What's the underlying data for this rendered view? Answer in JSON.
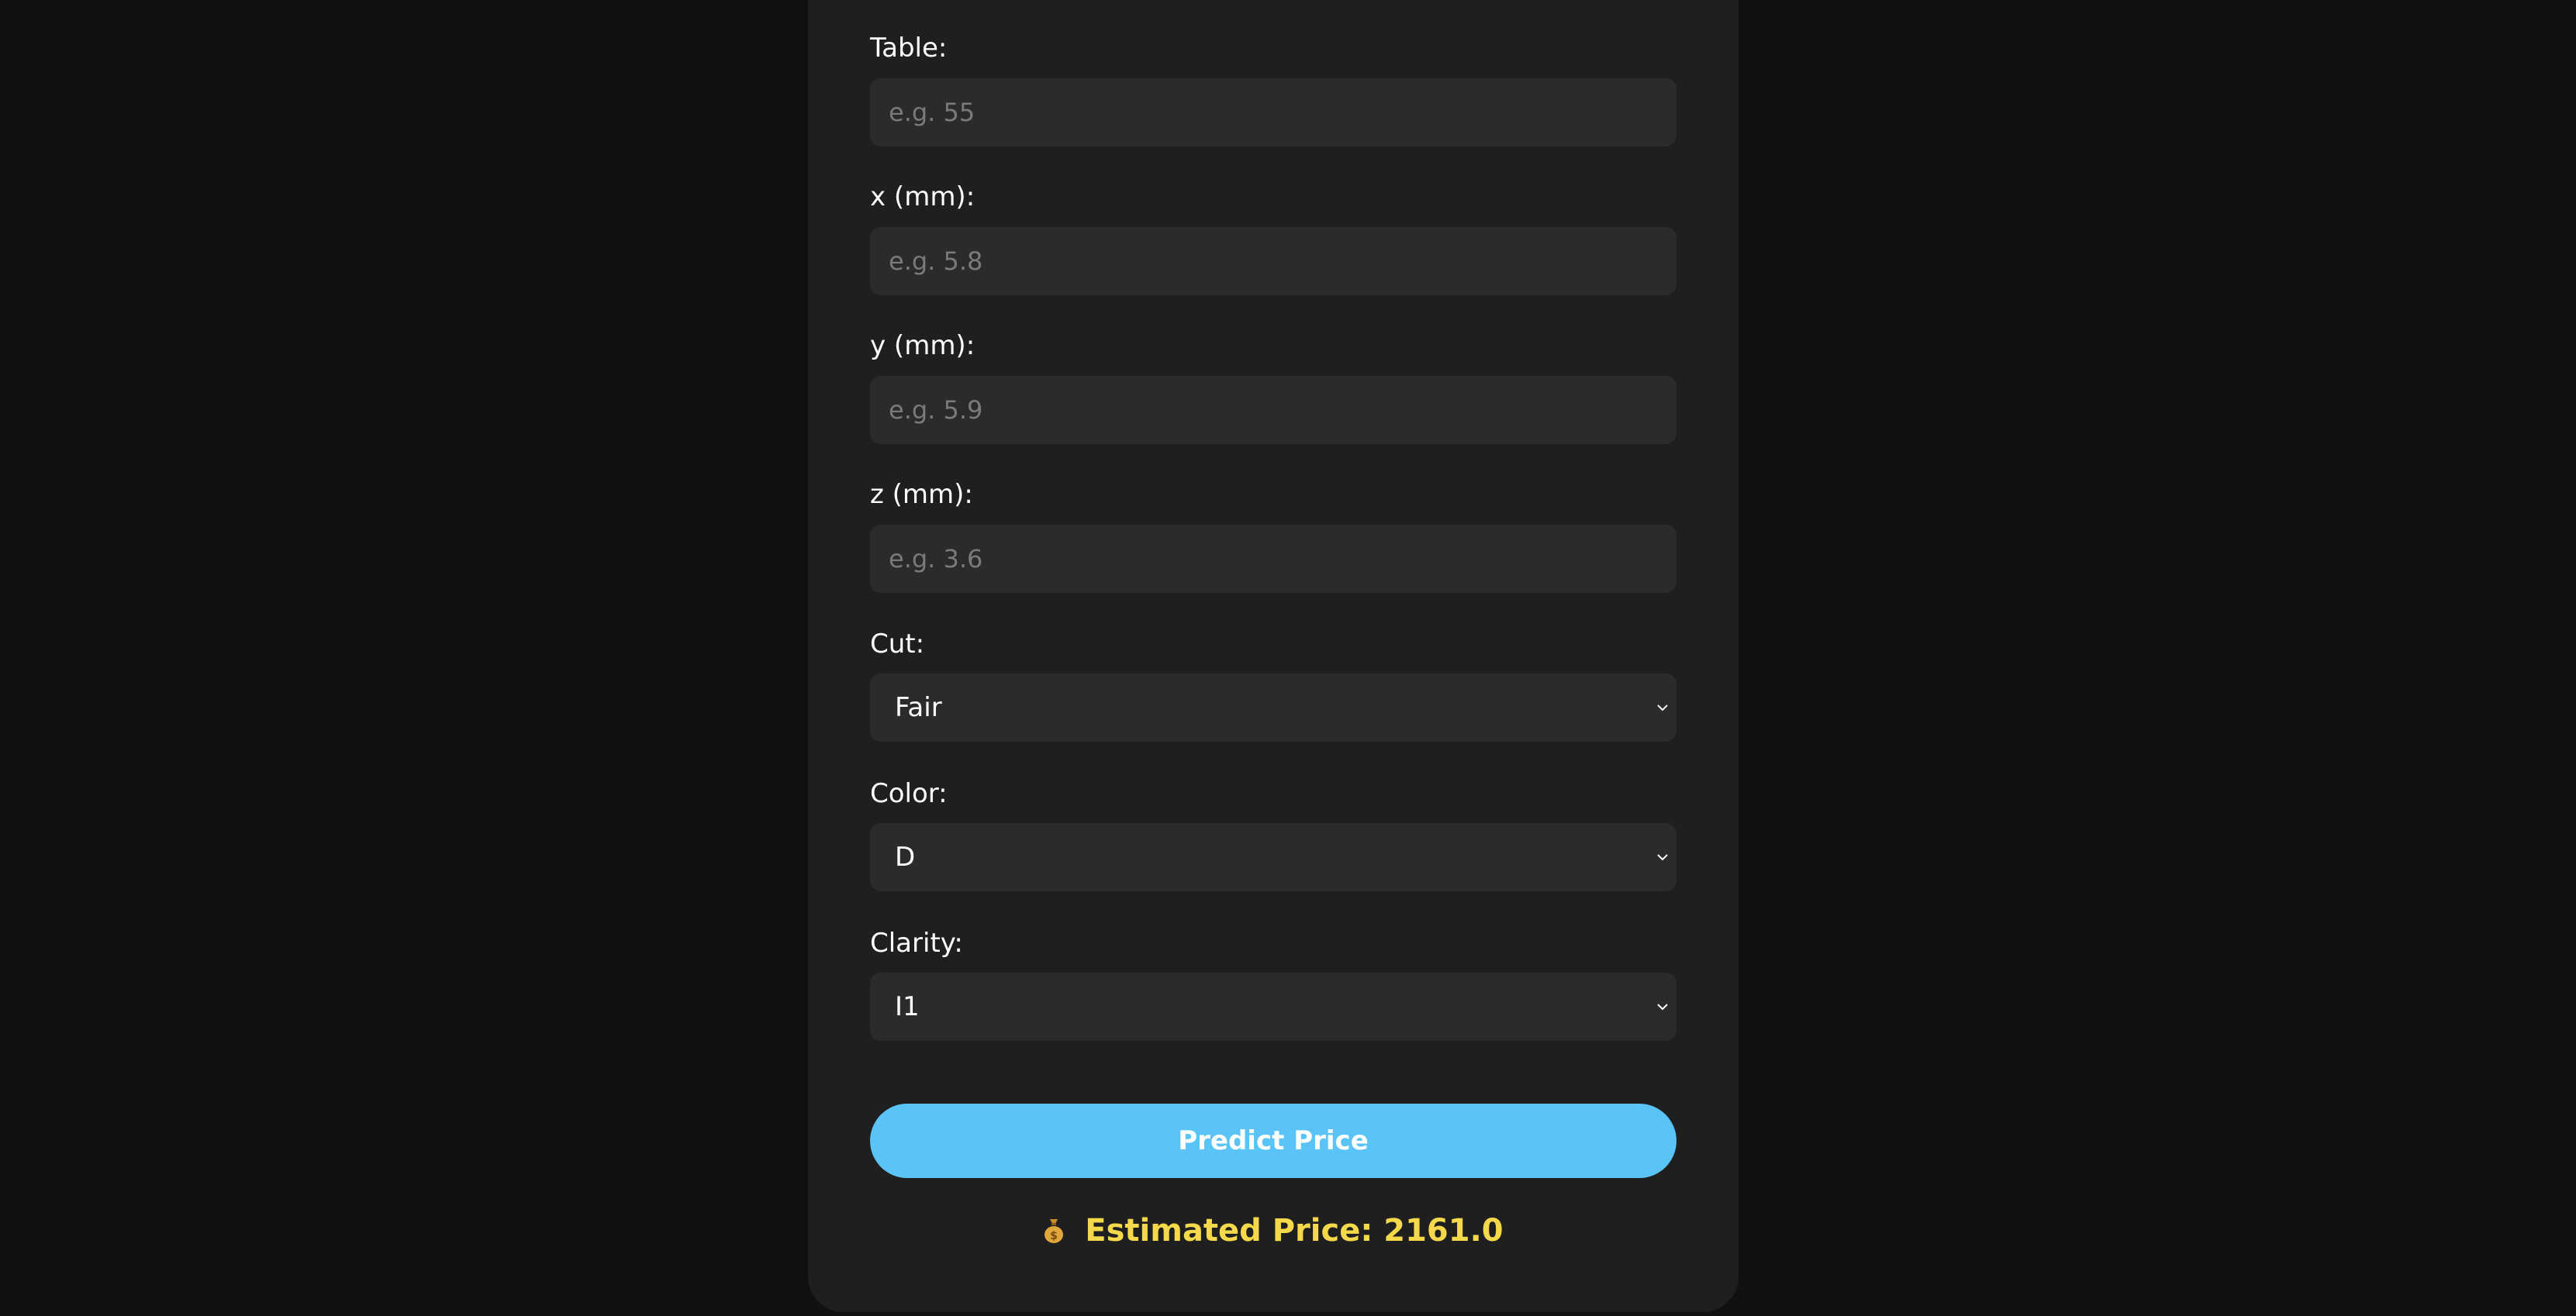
{
  "form": {
    "table": {
      "label": "Table:",
      "placeholder": "e.g. 55"
    },
    "x": {
      "label": "x (mm):",
      "placeholder": "e.g. 5.8"
    },
    "y": {
      "label": "y (mm):",
      "placeholder": "e.g. 5.9"
    },
    "z": {
      "label": "z (mm):",
      "placeholder": "e.g. 3.6"
    },
    "cut": {
      "label": "Cut:",
      "value": "Fair"
    },
    "color": {
      "label": "Color:",
      "value": "D"
    },
    "clarity": {
      "label": "Clarity:",
      "value": "I1"
    }
  },
  "actions": {
    "predict_label": "Predict Price"
  },
  "result": {
    "icon": "money-bag-icon",
    "text": "Estimated Price: 2161.0",
    "color": "#f5d94b"
  },
  "theme": {
    "background": "#111111",
    "card": "#1f1f1f",
    "input": "#2b2b2b",
    "accent": "#5ac4f8"
  }
}
